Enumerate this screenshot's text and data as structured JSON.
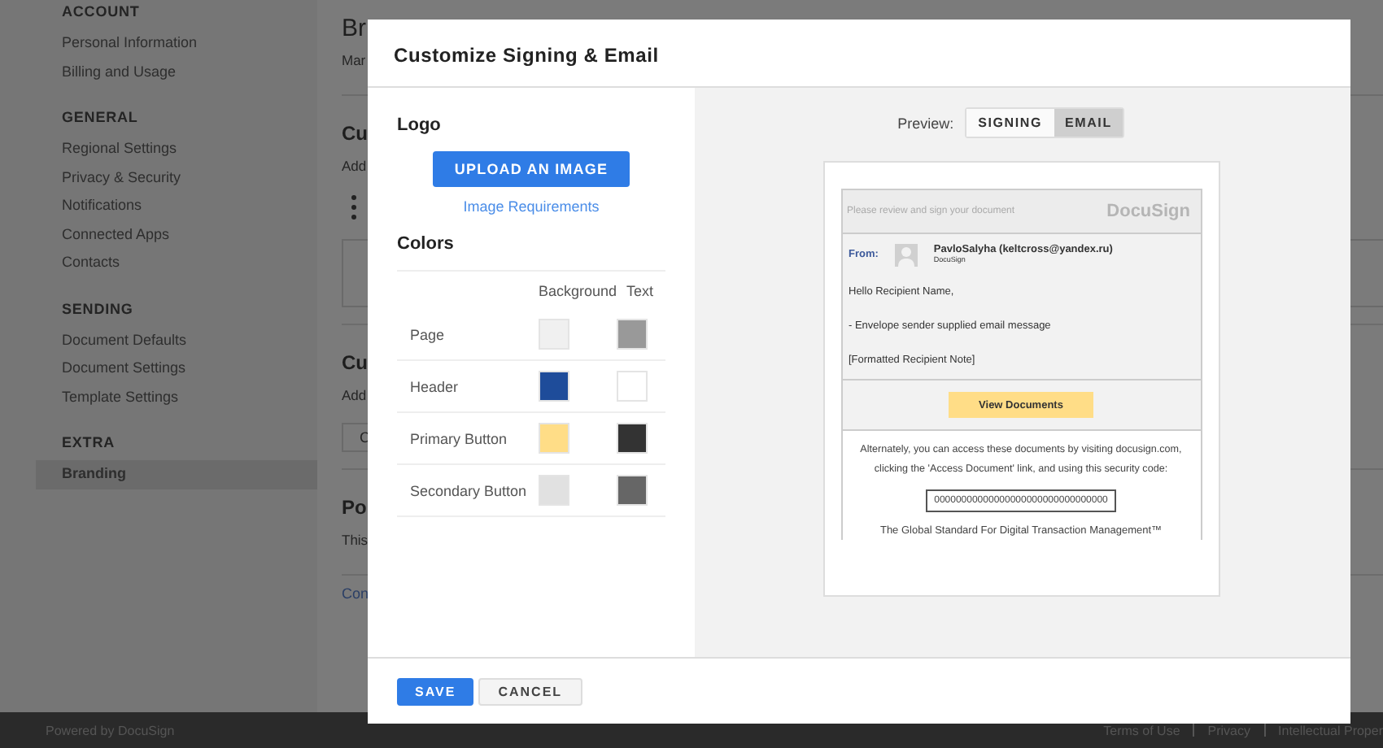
{
  "sidebar": {
    "sections": [
      {
        "heading": "ACCOUNT",
        "items": [
          {
            "label": "Personal Information",
            "selected": false
          },
          {
            "label": "Billing and Usage",
            "selected": false
          }
        ]
      },
      {
        "heading": "GENERAL",
        "items": [
          {
            "label": "Regional Settings",
            "selected": false
          },
          {
            "label": "Privacy & Security",
            "selected": false
          },
          {
            "label": "Notifications",
            "selected": false
          },
          {
            "label": "Connected Apps",
            "selected": false
          },
          {
            "label": "Contacts",
            "selected": false
          }
        ]
      },
      {
        "heading": "SENDING",
        "items": [
          {
            "label": "Document Defaults",
            "selected": false
          },
          {
            "label": "Document Settings",
            "selected": false
          },
          {
            "label": "Template Settings",
            "selected": false
          }
        ]
      },
      {
        "heading": "EXTRA",
        "items": [
          {
            "label": "Branding",
            "selected": true
          }
        ]
      }
    ]
  },
  "main": {
    "blocks": [
      {
        "kind": "title",
        "text": "Br"
      },
      {
        "kind": "text",
        "text": "Mar"
      },
      {
        "kind": "divider"
      },
      {
        "kind": "heading",
        "text": "Cu"
      },
      {
        "kind": "text",
        "text": "Add"
      },
      {
        "kind": "bullets"
      },
      {
        "kind": "box"
      },
      {
        "kind": "divider"
      },
      {
        "kind": "heading",
        "text": "Cu"
      },
      {
        "kind": "text",
        "text": "Add"
      },
      {
        "kind": "button",
        "text": "C"
      },
      {
        "kind": "divider"
      },
      {
        "kind": "heading",
        "text": "Po"
      },
      {
        "kind": "text",
        "text": "This"
      },
      {
        "kind": "divider"
      },
      {
        "kind": "link",
        "text": "Con"
      }
    ]
  },
  "footer": {
    "powered": "Powered by DocuSign",
    "links": [
      "Terms of Use",
      "Privacy",
      "Intellectual Proper"
    ]
  },
  "modal": {
    "title": "Customize Signing & Email",
    "logo": {
      "heading": "Logo",
      "upload_button": "UPLOAD AN IMAGE",
      "requirements_link": "Image Requirements"
    },
    "colors": {
      "heading": "Colors",
      "columns": [
        "Background",
        "Text"
      ],
      "rows": [
        {
          "label": "Page",
          "swatches": [
            {
              "color": "#f0f0f0"
            },
            {
              "color": "#999999"
            }
          ]
        },
        {
          "label": "Header",
          "swatches": [
            {
              "color": "#1e4c9a"
            },
            {
              "color": "#ffffff"
            }
          ]
        },
        {
          "label": "Primary Button",
          "swatches": [
            {
              "color": "#ffdd87"
            },
            {
              "color": "#333333"
            }
          ]
        },
        {
          "label": "Secondary Button",
          "swatches": [
            {
              "color": "#e1e1e1"
            },
            {
              "color": "#666666"
            }
          ]
        }
      ]
    },
    "preview": {
      "label": "Preview:",
      "tabs": [
        {
          "label": "SIGNING",
          "selected": false
        },
        {
          "label": "EMAIL",
          "selected": true
        }
      ],
      "email": {
        "header_text": "Please review and sign your document",
        "logo": "DocuSign",
        "from_label": "From:",
        "sender": "PavloSalyha (keltcross@yandex.ru)",
        "sender_company": "DocuSign",
        "body": [
          "Hello Recipient Name,",
          "- Envelope sender supplied email message",
          "[Formatted Recipient Note]"
        ],
        "button": "View Documents",
        "alternate_text": [
          "Alternately, you can access these documents by visiting docusign.com,",
          "clicking the 'Access Document' link, and using this security code:"
        ],
        "security_code": "00000000000000000000000000000000",
        "tagline": "The Global Standard For Digital Transaction Management™"
      }
    },
    "buttons": [
      {
        "label": "SAVE",
        "kind": "primary"
      },
      {
        "label": "CANCEL",
        "kind": "secondary"
      }
    ]
  }
}
